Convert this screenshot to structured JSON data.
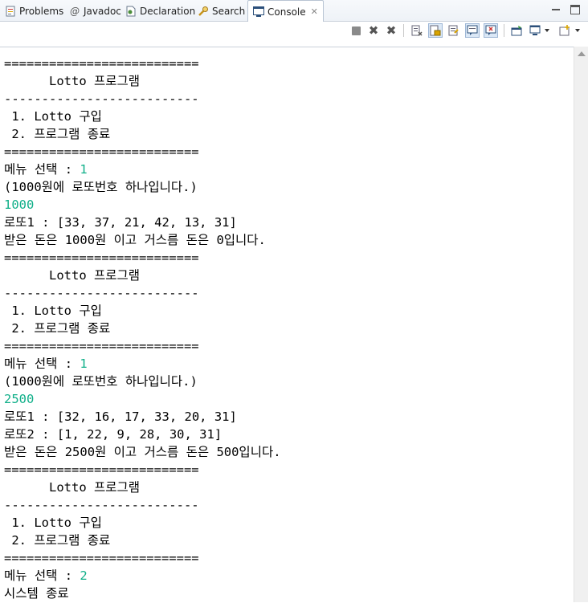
{
  "tabs": [
    {
      "label": "Problems",
      "icon": "problems-icon"
    },
    {
      "label": "Javadoc",
      "icon": "javadoc-icon"
    },
    {
      "label": "Declaration",
      "icon": "declaration-icon"
    },
    {
      "label": "Search",
      "icon": "search-icon"
    },
    {
      "label": "Console",
      "icon": "console-icon",
      "active": true
    }
  ],
  "colors": {
    "input_text": "#12b08a",
    "output_text": "#000000",
    "tab_bar": "#eef2f7"
  },
  "console": {
    "lines": [
      {
        "text": "==========================",
        "type": "output"
      },
      {
        "text": "      Lotto 프로그램",
        "type": "output"
      },
      {
        "text": "--------------------------",
        "type": "output"
      },
      {
        "text": " 1. Lotto 구입",
        "type": "output"
      },
      {
        "text": " 2. 프로그램 종료",
        "type": "output"
      },
      {
        "text": "==========================",
        "type": "output"
      },
      {
        "text": "메뉴 선택 : ",
        "type": "prompt",
        "input": "1"
      },
      {
        "text": "(1000원에 로또번호 하나입니다.)",
        "type": "output"
      },
      {
        "text": "1000",
        "type": "input"
      },
      {
        "text": "로또1 : [33, 37, 21, 42, 13, 31]",
        "type": "output"
      },
      {
        "text": "받은 돈은 1000원 이고 거스름 돈은 0입니다.",
        "type": "output"
      },
      {
        "text": "==========================",
        "type": "output"
      },
      {
        "text": "      Lotto 프로그램",
        "type": "output"
      },
      {
        "text": "--------------------------",
        "type": "output"
      },
      {
        "text": " 1. Lotto 구입",
        "type": "output"
      },
      {
        "text": " 2. 프로그램 종료",
        "type": "output"
      },
      {
        "text": "==========================",
        "type": "output"
      },
      {
        "text": "메뉴 선택 : ",
        "type": "prompt",
        "input": "1"
      },
      {
        "text": "(1000원에 로또번호 하나입니다.)",
        "type": "output"
      },
      {
        "text": "2500",
        "type": "input"
      },
      {
        "text": "로또1 : [32, 16, 17, 33, 20, 31]",
        "type": "output"
      },
      {
        "text": "로또2 : [1, 22, 9, 28, 30, 31]",
        "type": "output"
      },
      {
        "text": "받은 돈은 2500원 이고 거스름 돈은 500입니다.",
        "type": "output"
      },
      {
        "text": "==========================",
        "type": "output"
      },
      {
        "text": "      Lotto 프로그램",
        "type": "output"
      },
      {
        "text": "--------------------------",
        "type": "output"
      },
      {
        "text": " 1. Lotto 구입",
        "type": "output"
      },
      {
        "text": " 2. 프로그램 종료",
        "type": "output"
      },
      {
        "text": "==========================",
        "type": "output"
      },
      {
        "text": "메뉴 선택 : ",
        "type": "prompt",
        "input": "2"
      },
      {
        "text": "시스템 종료",
        "type": "output"
      }
    ]
  }
}
